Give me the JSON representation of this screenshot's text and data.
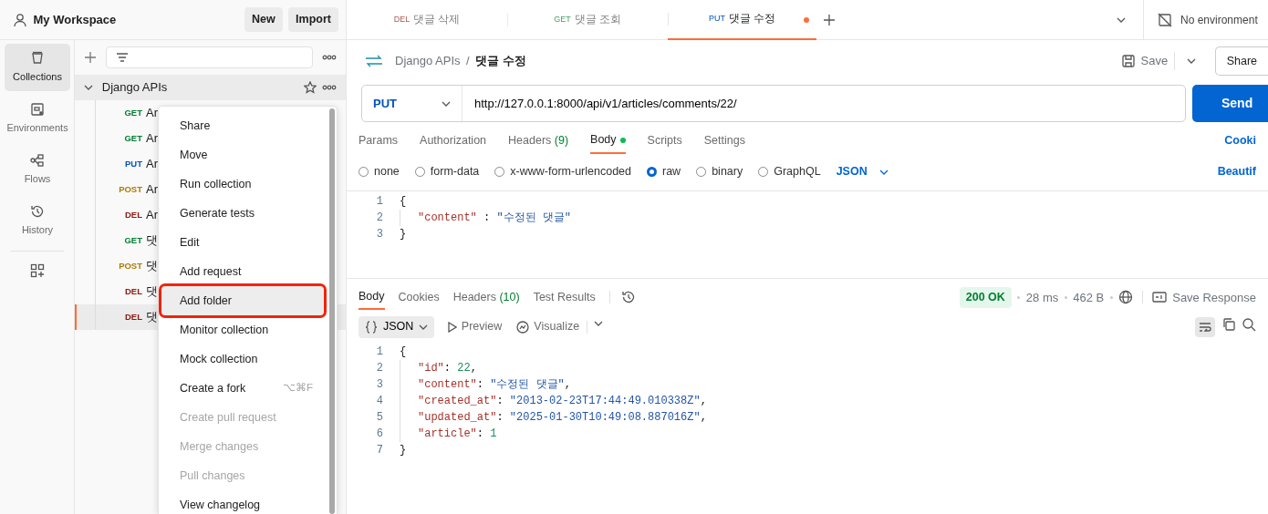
{
  "workspace": {
    "title": "My Workspace",
    "buttons": [
      "New",
      "Import"
    ]
  },
  "rail": [
    {
      "label": "Collections",
      "selected": true
    },
    {
      "label": "Environments",
      "selected": false
    },
    {
      "label": "Flows",
      "selected": false
    },
    {
      "label": "History",
      "selected": false
    }
  ],
  "collection": {
    "name": "Django APIs",
    "expanded": true,
    "requests": [
      {
        "method": "GET",
        "name": "Ar",
        "selected": false
      },
      {
        "method": "GET",
        "name": "Ar",
        "selected": false
      },
      {
        "method": "PUT",
        "name": "Ar",
        "selected": false
      },
      {
        "method": "POST",
        "name": "Ar",
        "selected": false
      },
      {
        "method": "DEL",
        "name": "Ar",
        "selected": false
      },
      {
        "method": "GET",
        "name": "댓",
        "selected": false
      },
      {
        "method": "POST",
        "name": "댓",
        "selected": false
      },
      {
        "method": "DEL",
        "name": "댓",
        "selected": false
      },
      {
        "method": "DEL",
        "name": "댓",
        "selected": true
      }
    ]
  },
  "context_menu": [
    {
      "label": "Share",
      "disabled": false,
      "highlighted": false
    },
    {
      "label": "Move",
      "disabled": false,
      "highlighted": false
    },
    {
      "label": "Run collection",
      "disabled": false,
      "highlighted": false
    },
    {
      "label": "Generate tests",
      "disabled": false,
      "highlighted": false
    },
    {
      "label": "Edit",
      "disabled": false,
      "highlighted": false
    },
    {
      "label": "Add request",
      "disabled": false,
      "highlighted": false
    },
    {
      "label": "Add folder",
      "disabled": false,
      "highlighted": true
    },
    {
      "label": "Monitor collection",
      "disabled": false,
      "highlighted": false
    },
    {
      "label": "Mock collection",
      "disabled": false,
      "highlighted": false
    },
    {
      "label": "Create a fork",
      "shortcut": "⌥⌘F",
      "disabled": false,
      "highlighted": false
    },
    {
      "label": "Create pull request",
      "disabled": true,
      "highlighted": false
    },
    {
      "label": "Merge changes",
      "disabled": true,
      "highlighted": false
    },
    {
      "label": "Pull changes",
      "disabled": true,
      "highlighted": false
    },
    {
      "label": "View changelog",
      "disabled": false,
      "highlighted": false
    }
  ],
  "tabs": [
    {
      "method": "DEL",
      "title": "댓글 삭제",
      "selected": false,
      "unsaved": false
    },
    {
      "method": "GET",
      "title": "댓글 조회",
      "selected": false,
      "unsaved": false
    },
    {
      "method": "PUT",
      "title": "댓글 수정",
      "selected": true,
      "unsaved": true
    }
  ],
  "environment": "No environment",
  "breadcrumb": {
    "collection": "Django APIs",
    "separator": "/",
    "request": "댓글 수정"
  },
  "save": "Save",
  "share": "Share",
  "request": {
    "method": "PUT",
    "url": "http://127.0.0.1:8000/api/v1/articles/comments/22/",
    "send": "Send"
  },
  "request_tabs": [
    {
      "label": "Params",
      "selected": false,
      "dot": false
    },
    {
      "label": "Authorization",
      "selected": false,
      "dot": false
    },
    {
      "label": "Headers",
      "count": "(9)",
      "selected": false,
      "dot": false
    },
    {
      "label": "Body",
      "selected": true,
      "dot": true
    },
    {
      "label": "Scripts",
      "selected": false,
      "dot": false
    },
    {
      "label": "Settings",
      "selected": false,
      "dot": false
    }
  ],
  "cookies_link": "Cooki",
  "body_types": [
    {
      "label": "none",
      "selected": false
    },
    {
      "label": "form-data",
      "selected": false
    },
    {
      "label": "x-www-form-urlencoded",
      "selected": false
    },
    {
      "label": "raw",
      "selected": true
    },
    {
      "label": "binary",
      "selected": false
    },
    {
      "label": "GraphQL",
      "selected": false
    }
  ],
  "body_format": "JSON",
  "beautify": "Beautif",
  "request_body": [
    {
      "number": "1",
      "tokens": [
        {
          "kind": "punct",
          "text": "{"
        }
      ]
    },
    {
      "number": "2",
      "tokens": [
        {
          "kind": "key",
          "text": "\"content\""
        },
        {
          "kind": "punct",
          "text": " : "
        },
        {
          "kind": "string",
          "text": "\"수정된 댓글\""
        }
      ]
    },
    {
      "number": "3",
      "tokens": [
        {
          "kind": "punct",
          "text": "}"
        }
      ]
    }
  ],
  "response_tabs": [
    {
      "label": "Body",
      "selected": true
    },
    {
      "label": "Cookies",
      "selected": false
    },
    {
      "label": "Headers",
      "count": "(10)",
      "selected": false
    },
    {
      "label": "Test Results",
      "selected": false
    }
  ],
  "status": "200 OK",
  "time": "28 ms",
  "size": "462 B",
  "save_response": "Save Response",
  "response_toolbar": {
    "format": "JSON",
    "preview": "Preview",
    "visualize": "Visualize"
  },
  "response_body": [
    {
      "number": "1",
      "tokens": [
        {
          "kind": "punct",
          "text": "{"
        }
      ]
    },
    {
      "number": "2",
      "tokens": [
        {
          "kind": "key",
          "text": "\"id\""
        },
        {
          "kind": "punct",
          "text": ": "
        },
        {
          "kind": "number",
          "text": "22"
        },
        {
          "kind": "punct",
          "text": ","
        }
      ]
    },
    {
      "number": "3",
      "tokens": [
        {
          "kind": "key",
          "text": "\"content\""
        },
        {
          "kind": "punct",
          "text": ": "
        },
        {
          "kind": "string",
          "text": "\"수정된 댓글\""
        },
        {
          "kind": "punct",
          "text": ","
        }
      ]
    },
    {
      "number": "4",
      "tokens": [
        {
          "kind": "key",
          "text": "\"created_at\""
        },
        {
          "kind": "punct",
          "text": ": "
        },
        {
          "kind": "string",
          "text": "\"2013-02-23T17:44:49.010338Z\""
        },
        {
          "kind": "punct",
          "text": ","
        }
      ]
    },
    {
      "number": "5",
      "tokens": [
        {
          "kind": "key",
          "text": "\"updated_at\""
        },
        {
          "kind": "punct",
          "text": ": "
        },
        {
          "kind": "string",
          "text": "\"2025-01-30T10:49:08.887016Z\""
        },
        {
          "kind": "punct",
          "text": ","
        }
      ]
    },
    {
      "number": "6",
      "tokens": [
        {
          "kind": "key",
          "text": "\"article\""
        },
        {
          "kind": "punct",
          "text": ": "
        },
        {
          "kind": "number",
          "text": "1"
        }
      ]
    },
    {
      "number": "7",
      "tokens": [
        {
          "kind": "punct",
          "text": "}"
        }
      ]
    }
  ]
}
